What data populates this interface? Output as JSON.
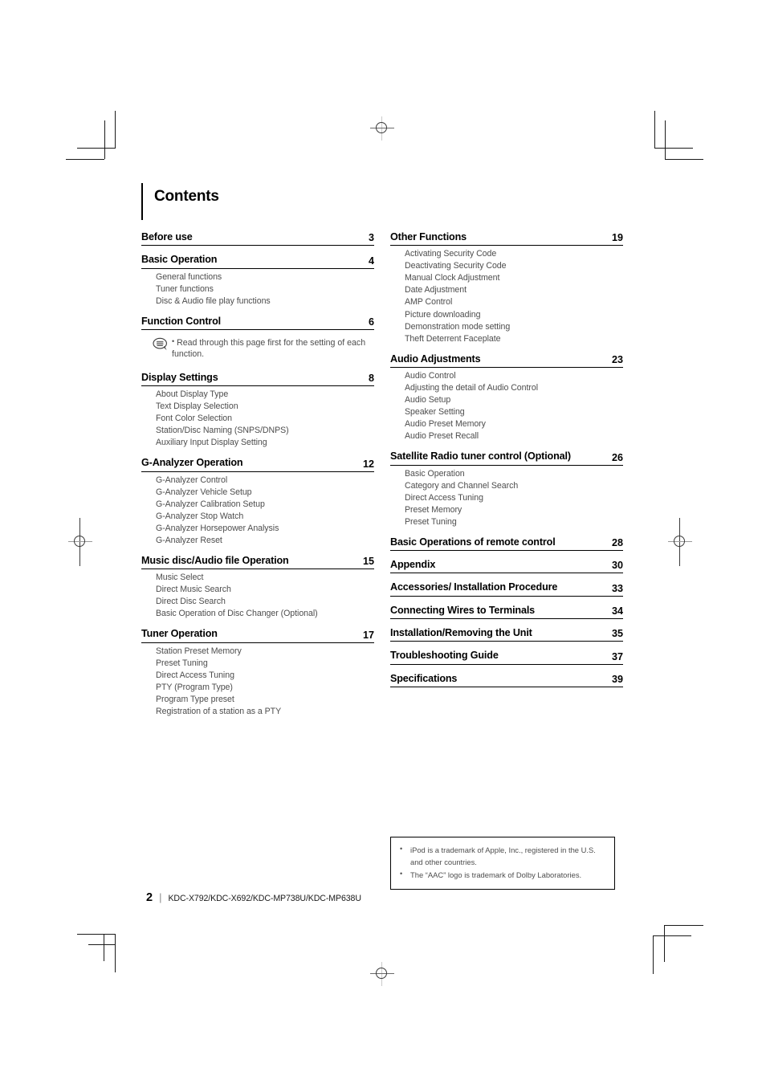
{
  "document": {
    "title": "Contents",
    "page_number": "2",
    "models": "KDC-X792/KDC-X692/KDC-MP738U/KDC-MP638U"
  },
  "left_column": [
    {
      "title": "Before use",
      "page": "3",
      "items": []
    },
    {
      "title": "Basic Operation",
      "page": "4",
      "items": [
        "General functions",
        "Tuner functions",
        "Disc & Audio file play functions"
      ]
    },
    {
      "title": "Function Control",
      "page": "6",
      "items": [],
      "note": {
        "icon": "speech-bubble-icon",
        "bullet": "•",
        "text": "Read through this page first for the setting of each function."
      }
    },
    {
      "title": "Display Settings",
      "page": "8",
      "items": [
        "About Display Type",
        "Text Display Selection",
        "Font Color Selection",
        "Station/Disc Naming (SNPS/DNPS)",
        "Auxiliary Input Display Setting"
      ]
    },
    {
      "title": "G-Analyzer Operation",
      "page": "12",
      "items": [
        "G-Analyzer Control",
        "G-Analyzer Vehicle Setup",
        "G-Analyzer Calibration Setup",
        "G-Analyzer Stop Watch",
        "G-Analyzer Horsepower Analysis",
        "G-Analyzer Reset"
      ]
    },
    {
      "title": "Music disc/Audio file Operation",
      "page": "15",
      "items": [
        "Music Select",
        "Direct Music Search",
        "Direct Disc Search",
        "Basic Operation of Disc Changer (Optional)"
      ]
    },
    {
      "title": "Tuner Operation",
      "page": "17",
      "items": [
        "Station Preset Memory",
        "Preset Tuning",
        "Direct Access Tuning",
        "PTY (Program Type)",
        "Program Type preset",
        "Registration of a station as a PTY"
      ]
    }
  ],
  "right_column": [
    {
      "title": "Other Functions",
      "page": "19",
      "items": [
        "Activating Security Code",
        "Deactivating Security Code",
        "Manual Clock Adjustment",
        "Date Adjustment",
        "AMP Control",
        "Picture downloading",
        "Demonstration mode setting",
        "Theft Deterrent Faceplate"
      ]
    },
    {
      "title": "Audio Adjustments",
      "page": "23",
      "items": [
        "Audio Control",
        "Adjusting the detail of Audio Control",
        "Audio Setup",
        "Speaker Setting",
        "Audio Preset Memory",
        "Audio Preset Recall"
      ]
    },
    {
      "title": "Satellite Radio tuner control (Optional)",
      "page": "26",
      "items": [
        "Basic Operation",
        "Category and Channel Search",
        "Direct Access Tuning",
        "Preset Memory",
        "Preset Tuning"
      ]
    },
    {
      "title": "Basic Operations of remote control",
      "page": "28",
      "items": []
    },
    {
      "title": "Appendix",
      "page": "30",
      "items": []
    },
    {
      "title": "Accessories/ Installation Procedure",
      "page": "33",
      "items": []
    },
    {
      "title": "Connecting Wires to Terminals",
      "page": "34",
      "items": []
    },
    {
      "title": "Installation/Removing the Unit",
      "page": "35",
      "items": []
    },
    {
      "title": "Troubleshooting Guide",
      "page": "37",
      "items": []
    },
    {
      "title": "Specifications",
      "page": "39",
      "items": []
    }
  ],
  "trademark_box": {
    "items": [
      "iPod is a trademark of Apple, Inc., registered in the U.S. and other countries.",
      "The “AAC” logo is trademark of Dolby Laboratories."
    ]
  }
}
